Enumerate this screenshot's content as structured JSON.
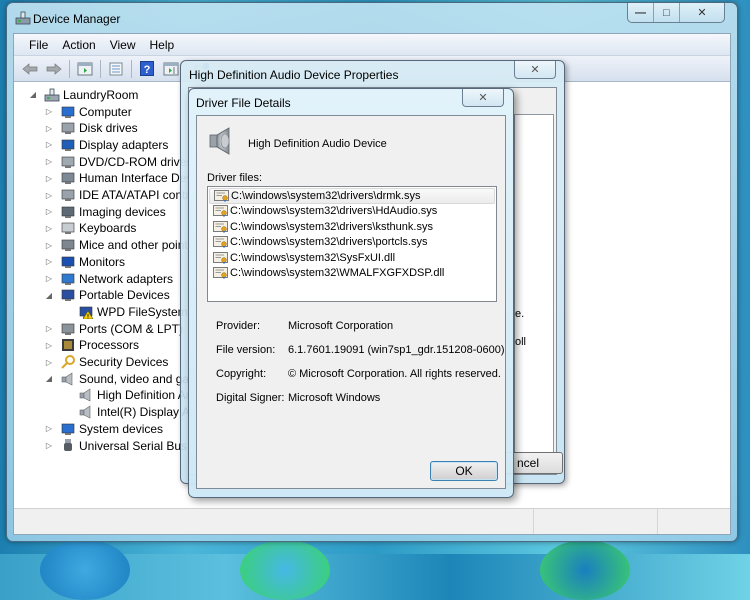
{
  "window": {
    "title": "Device Manager",
    "caption_buttons": {
      "minimize": "—",
      "maximize": "□",
      "close": "✕"
    }
  },
  "menu": [
    {
      "label": "File"
    },
    {
      "label": "Action"
    },
    {
      "label": "View"
    },
    {
      "label": "Help"
    }
  ],
  "toolbar": {
    "buttons": [
      {
        "icon": "back-arrow-icon"
      },
      {
        "icon": "forward-arrow-icon"
      },
      {
        "icon": "show-hide-console-tree-icon"
      },
      {
        "icon": "properties-icon"
      },
      {
        "icon": "help-icon",
        "glyph": "?"
      },
      {
        "icon": "show-hide-action-pane-icon"
      },
      {
        "icon": "scan-hardware-icon"
      }
    ]
  },
  "tree": {
    "root": "LaundryRoom",
    "items": [
      {
        "label": "Computer",
        "expanded": false,
        "icon": "computer-icon"
      },
      {
        "label": "Disk drives",
        "expanded": false,
        "icon": "disk-drive-icon"
      },
      {
        "label": "Display adapters",
        "expanded": false,
        "icon": "display-adapter-icon"
      },
      {
        "label": "DVD/CD-ROM drives",
        "expanded": false,
        "icon": "dvd-drive-icon"
      },
      {
        "label": "Human Interface Devic",
        "expanded": false,
        "icon": "hid-icon"
      },
      {
        "label": "IDE ATA/ATAPI contro",
        "expanded": false,
        "icon": "ide-controller-icon"
      },
      {
        "label": "Imaging devices",
        "expanded": false,
        "icon": "camera-icon"
      },
      {
        "label": "Keyboards",
        "expanded": false,
        "icon": "keyboard-icon"
      },
      {
        "label": "Mice and other pointin",
        "expanded": false,
        "icon": "mouse-icon"
      },
      {
        "label": "Monitors",
        "expanded": false,
        "icon": "monitor-icon"
      },
      {
        "label": "Network adapters",
        "expanded": false,
        "icon": "network-adapter-icon"
      },
      {
        "label": "Portable Devices",
        "expanded": true,
        "icon": "portable-device-icon"
      },
      {
        "label": "WPD FileSystem Vo",
        "child": true,
        "warning": true,
        "icon": "wpd-warning-icon"
      },
      {
        "label": "Ports (COM & LPT)",
        "expanded": false,
        "icon": "port-icon"
      },
      {
        "label": "Processors",
        "expanded": false,
        "icon": "processor-icon"
      },
      {
        "label": "Security Devices",
        "expanded": false,
        "icon": "key-icon"
      },
      {
        "label": "Sound, video and gam",
        "expanded": true,
        "icon": "speaker-icon"
      },
      {
        "label": "High Definition Au",
        "child": true,
        "icon": "speaker-icon"
      },
      {
        "label": "Intel(R) Display Au",
        "child": true,
        "icon": "speaker-icon"
      },
      {
        "label": "System devices",
        "expanded": false,
        "icon": "system-device-icon"
      },
      {
        "label": "Universal Serial Bus co",
        "expanded": false,
        "icon": "usb-icon"
      }
    ]
  },
  "properties_dialog": {
    "title": "High Definition Audio Device Properties",
    "close_glyph": "✕",
    "cancel_label": "ncel",
    "fragments": [
      "e.",
      "oll"
    ]
  },
  "driver_dialog": {
    "title": "Driver File Details",
    "close_glyph": "✕",
    "device_name": "High Definition Audio Device",
    "files_label": "Driver files:",
    "files": [
      "C:\\windows\\system32\\drivers\\drmk.sys",
      "C:\\windows\\system32\\drivers\\HdAudio.sys",
      "C:\\windows\\system32\\drivers\\ksthunk.sys",
      "C:\\windows\\system32\\drivers\\portcls.sys",
      "C:\\windows\\system32\\SysFxUI.dll",
      "C:\\windows\\system32\\WMALFXGFXDSP.dll"
    ],
    "selected_index": 0,
    "provider_label": "Provider:",
    "provider": "Microsoft Corporation",
    "file_version_label": "File version:",
    "file_version": "6.1.7601.19091 (win7sp1_gdr.151208-0600)",
    "copyright_label": "Copyright:",
    "copyright": "© Microsoft Corporation. All rights reserved.",
    "signer_label": "Digital Signer:",
    "signer": "Microsoft Windows",
    "ok_label": "OK"
  },
  "colors": {
    "title_glass": "#c3e4f2",
    "dialog_face": "#f0f0f0",
    "ok_focus_border": "#3c7fb1"
  }
}
